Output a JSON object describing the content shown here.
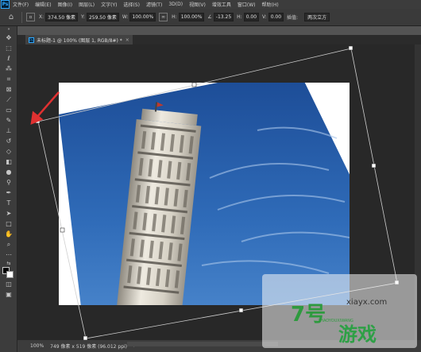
{
  "app": {
    "logo": "Ps"
  },
  "menu": [
    "文件(F)",
    "编辑(E)",
    "图像(I)",
    "图层(L)",
    "文字(Y)",
    "选择(S)",
    "滤镜(T)",
    "3D(D)",
    "视图(V)",
    "增效工具",
    "窗口(W)",
    "帮助(H)"
  ],
  "options": {
    "x_label": "X:",
    "x_value": "374.50 像素",
    "y_label": "Y:",
    "y_value": "259.50 像素",
    "w_label": "W:",
    "w_value": "100.00%",
    "h_label": "H:",
    "h_value": "100.00%",
    "angle_value": "-13.25",
    "hskew_label": "H:",
    "hskew_value": "0.00",
    "vskew_label": "V:",
    "vskew_value": "0.00",
    "interp_label": "插值:",
    "interp_value": "两次立方"
  },
  "tab": {
    "title": "未标题-1 @ 100% (图层 1, RGB/8#) *",
    "close": "×"
  },
  "status": {
    "zoom": "100%",
    "info": "749 像素 x 519 像素 (96.012 ppi)",
    "arrow": "›"
  },
  "watermark": {
    "mark": "7号",
    "url": "xiayx.com",
    "cn": "游戏",
    "sub": "7HAOYOUXIWANG"
  },
  "colors": {
    "accent": "#31a8ff",
    "sky_top": "#1b4a94",
    "sky_bottom": "#3f7fc8",
    "annotation_arrow": "#e03131"
  }
}
